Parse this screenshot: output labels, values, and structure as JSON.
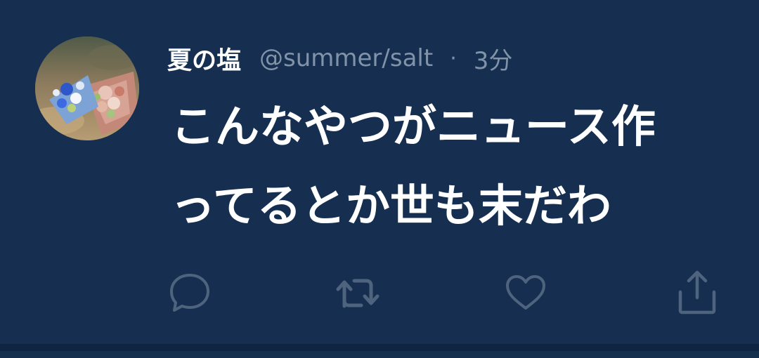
{
  "tweet": {
    "author_name": "夏の塩",
    "handle": "@summer/salt",
    "separator": "·",
    "time": "3分",
    "text_lines": [
      "こんなやつがニュース作",
      "ってるとか世も末だわ"
    ]
  },
  "actions": {
    "reply_icon": "reply-icon",
    "retweet_icon": "retweet-icon",
    "like_icon": "heart-icon",
    "share_icon": "share-icon"
  },
  "colors": {
    "background": "#162f50",
    "text": "#ffffff",
    "secondary": "#8193a8",
    "icon": "#4e647e"
  }
}
